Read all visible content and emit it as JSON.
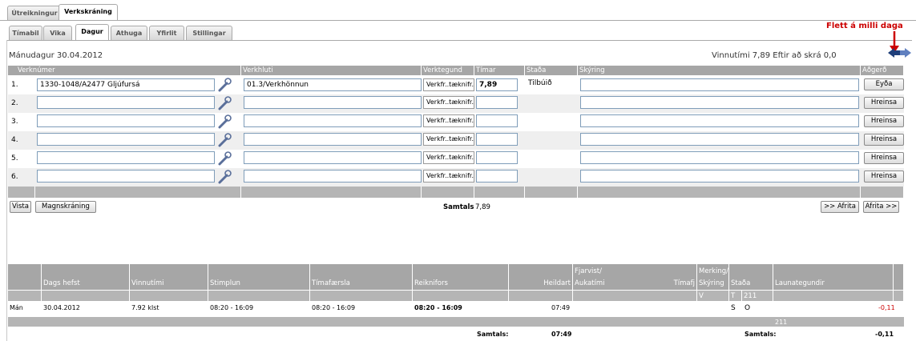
{
  "top_tabs": [
    "Útreikningur",
    "Verkskráning"
  ],
  "sub_tabs": [
    "Tímabil",
    "Vika",
    "Dagur",
    "Athuga",
    "Yfirlit",
    "Stillingar"
  ],
  "nav_hint": "Flett á  milli daga",
  "date_label": "Mánudagur 30.04.2012",
  "hours_summary": "Vinnutími 7,89 Eftir að skrá 0,0",
  "entry_table": {
    "headers": {
      "verknumer": "Verknúmer",
      "verkhluti": "Verkhluti",
      "verktegund": "Verktegund",
      "timar": "Tímar",
      "stada": "Staða",
      "skyring": "Skýring",
      "adgerd": "Aðgerð"
    },
    "rows": [
      {
        "num": "1.",
        "verknumer": "1330-1048/A2477 Gljúfursá",
        "verkhluti": "01.3/Verkhönnun",
        "verktegund": "Verkfr..tæknifr.\\",
        "timar": "7,89",
        "stada": "Tilbúið",
        "skyring": "",
        "action": "Eyða"
      },
      {
        "num": "2.",
        "verknumer": "",
        "verkhluti": "",
        "verktegund": "Verkfr..tæknifr.\\",
        "timar": "",
        "stada": "",
        "skyring": "",
        "action": "Hreinsa"
      },
      {
        "num": "3.",
        "verknumer": "",
        "verkhluti": "",
        "verktegund": "Verkfr..tæknifr.\\",
        "timar": "",
        "stada": "",
        "skyring": "",
        "action": "Hreinsa"
      },
      {
        "num": "4.",
        "verknumer": "",
        "verkhluti": "",
        "verktegund": "Verkfr..tæknifr.\\",
        "timar": "",
        "stada": "",
        "skyring": "",
        "action": "Hreinsa"
      },
      {
        "num": "5.",
        "verknumer": "",
        "verkhluti": "",
        "verktegund": "Verkfr..tæknifr.\\",
        "timar": "",
        "stada": "",
        "skyring": "",
        "action": "Hreinsa"
      },
      {
        "num": "6.",
        "verknumer": "",
        "verkhluti": "",
        "verktegund": "Verkfr..tæknifr.\\",
        "timar": "",
        "stada": "",
        "skyring": "",
        "action": "Hreinsa"
      }
    ],
    "total_label": "Samtals",
    "total_value": "7,89"
  },
  "buttons": {
    "vista": "Vista",
    "magnskraning": "Magnskráning",
    "afrita_prev": ">> Afrita",
    "afrita_next": "Afrita >>"
  },
  "summary_table": {
    "headers": {
      "dags": "Dags hefst",
      "vinnutimi": "Vinnutími",
      "stimplun": "Stimplun",
      "timafaersla": "Tímafærsla",
      "reiknifors": "Reiknifors",
      "fjarvist_top": "Fjarvist/",
      "heildart": "Heildart",
      "aukatimi": "Aukatími",
      "timafj": "Tímafj",
      "merking_top": "Merking/",
      "skyring": "Skýring",
      "stada": "Staða",
      "launategundir": "Launategundir"
    },
    "subrow": {
      "v": "V",
      "t": "T",
      "code": "211"
    },
    "data_row": {
      "day": "Mán",
      "date": "30.04.2012",
      "vinnutimi": "7.92 klst",
      "stimplun": "08:20 - 16:09",
      "timafaersla": "08:20 - 16:09",
      "reiknifors": "08:20 - 16:09",
      "heildart": "07:49",
      "s": "S",
      "o": "O",
      "amount": "-0,11"
    },
    "code_row": "211",
    "totals": {
      "label1": "Samtals:",
      "value1": "07:49",
      "label2": "Samtals:",
      "value2": "-0,11"
    }
  },
  "colors": {
    "header_gray": "#a6a6a6",
    "alt_row": "#efefef",
    "hint_red": "#cc0000",
    "negative": "#cc0000"
  }
}
